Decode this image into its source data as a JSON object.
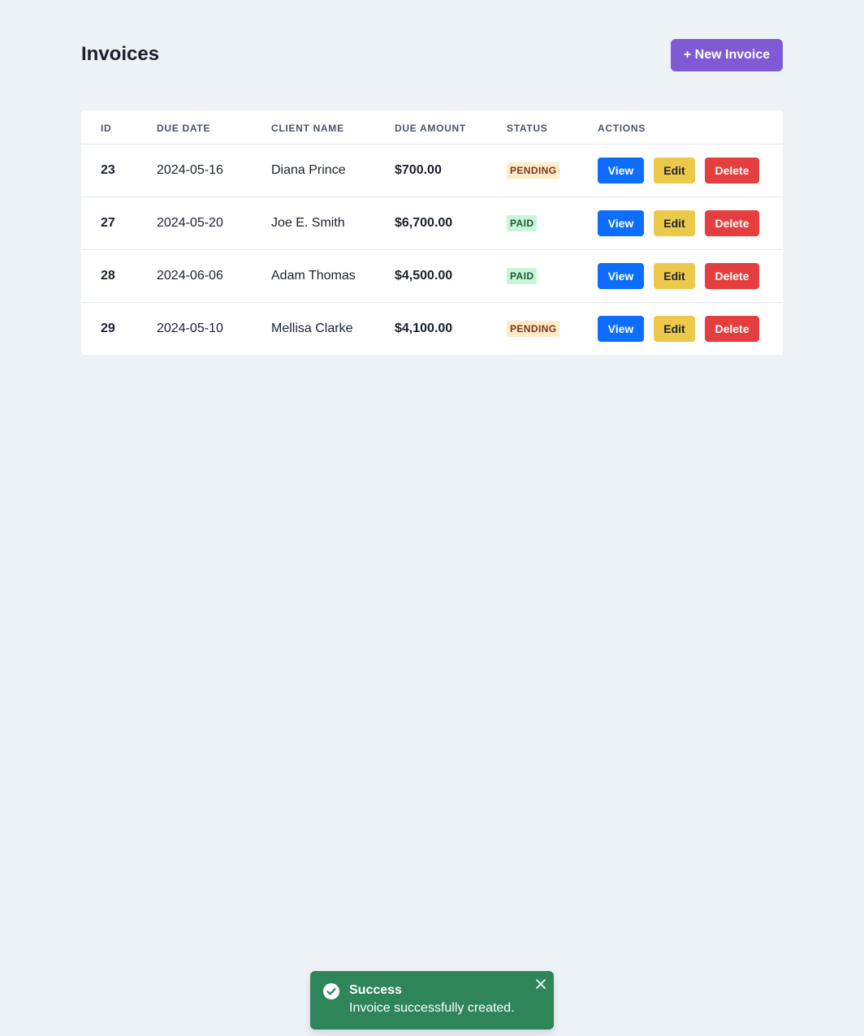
{
  "page": {
    "title": "Invoices",
    "new_button_label": "+ New Invoice"
  },
  "table": {
    "headers": [
      "ID",
      "DUE DATE",
      "CLIENT NAME",
      "DUE AMOUNT",
      "STATUS",
      "ACTIONS"
    ],
    "rows": [
      {
        "id": "23",
        "due_date": "2024-05-16",
        "client": "Diana Prince",
        "amount": "$700.00",
        "status": "PENDING"
      },
      {
        "id": "27",
        "due_date": "2024-05-20",
        "client": "Joe E. Smith",
        "amount": "$6,700.00",
        "status": "PAID"
      },
      {
        "id": "28",
        "due_date": "2024-06-06",
        "client": "Adam Thomas",
        "amount": "$4,500.00",
        "status": "PAID"
      },
      {
        "id": "29",
        "due_date": "2024-05-10",
        "client": "Mellisa Clarke",
        "amount": "$4,100.00",
        "status": "PENDING"
      }
    ],
    "action_labels": {
      "view": "View",
      "edit": "Edit",
      "delete": "Delete"
    }
  },
  "toast": {
    "title": "Success",
    "message": "Invoice successfully created.",
    "icon": "check-circle-icon",
    "close_icon": "close-icon"
  },
  "colors": {
    "background": "#edf2f7",
    "primary_purple": "#805ad5",
    "view_blue": "#0d6efd",
    "edit_yellow": "#ecc94b",
    "delete_red": "#e53e3e",
    "success_green": "#2f855a",
    "pending_badge_bg": "#feebc8",
    "paid_badge_bg": "#c6f6d5"
  }
}
